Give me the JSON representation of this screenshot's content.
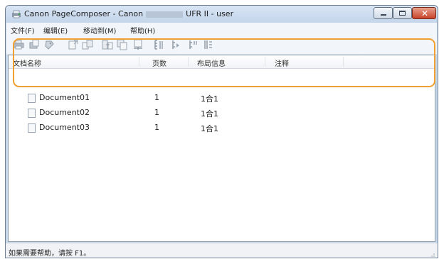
{
  "window": {
    "title_prefix": "Canon PageComposer - Canon",
    "title_suffix": "UFR II - user",
    "controls": {
      "minimize_icon": "minimize-icon",
      "maximize_icon": "maximize-icon",
      "close_icon": "close-icon",
      "close_glyph": "✕"
    }
  },
  "menu": [
    {
      "label": "文件(F)"
    },
    {
      "label": "编辑(E)"
    },
    {
      "label": "移动到(M)"
    },
    {
      "label": "帮助(H)"
    }
  ],
  "toolbar": {
    "tools": [
      "print-icon",
      "print-preview-icon",
      "properties-icon",
      "combine-icon",
      "split-icon",
      "move-to-icon",
      "duplicate-icon",
      "delete-icon",
      "move-to-top-icon",
      "move-up-icon",
      "move-down-icon",
      "move-to-bottom-icon"
    ]
  },
  "list": {
    "columns": [
      "文档名称",
      "页数",
      "布局信息",
      "注释"
    ],
    "rows": [
      {
        "name": "Document01",
        "pages": "1",
        "layout": "1合1",
        "note": ""
      },
      {
        "name": "Document02",
        "pages": "1",
        "layout": "1合1",
        "note": ""
      },
      {
        "name": "Document03",
        "pages": "1",
        "layout": "1合1",
        "note": ""
      }
    ],
    "highlight_color": "#f0a030"
  },
  "status": {
    "text": "如果需要帮助，请按 F1。"
  },
  "colors": {
    "title_bar": "#c9d9ec",
    "close_button": "#c7432a",
    "highlight": "#f0a030"
  }
}
